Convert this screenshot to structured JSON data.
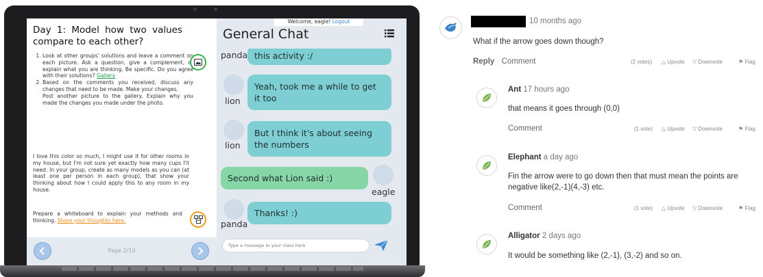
{
  "lesson": {
    "title": "Day 1: Model how two values compare to each other?",
    "steps": [
      {
        "text": "Look at other groups' solutions and leave a comment on each picture. Ask a question, give a complement, or explain what you are thinking. Be specific. Do you agree with their solutions? ",
        "link": "Gallery"
      },
      {
        "text": "Based on the comments you received, discuss any changes that need to be made. Make your changes.",
        "extra": "Post another picture to the gallery. Explain why you made the changes you made under the photo."
      }
    ],
    "paragraph": "I love this color so much, I might use it for other rooms in my house, but I'm not sure yet exactly how many cups I'll need. In your group, create as many models as you can (at least one per person in each group), that show your thinking about how I could apply this to any room in my house.",
    "prepare_text": "Prepare a whiteboard to explain your methods and thinking. ",
    "prepare_link": "Share your thoughts here.",
    "page_label": "Page 2/10",
    "icons": [
      "gallery-icon",
      "whiteboard-icon",
      "prev-arrow-icon",
      "next-arrow-icon"
    ]
  },
  "chat": {
    "welcome": "Welcome, eagle!",
    "logout": "Logout",
    "title": "General Chat",
    "messages": [
      {
        "user": "panda",
        "text": "this activity :/"
      },
      {
        "user": "lion",
        "text": "Yeah, took me a while to get it too"
      },
      {
        "user": "lion",
        "text": "But I think it's about seeing the numbers"
      },
      {
        "user": "eagle",
        "text": "Second what Lion said :)"
      },
      {
        "user": "panda",
        "text": "Thanks! :)"
      }
    ],
    "input_placeholder": "Type a message to your class here",
    "colors": {
      "bubble": "#7ecfd4",
      "own_bubble": "#86d6a8",
      "background": "#e4e8ef"
    }
  },
  "thread": {
    "post": {
      "time": "10 months ago",
      "text": "What if the arrow goes down though?",
      "reply": "Reply",
      "comment": "Comment",
      "votes": "(2 votes)"
    },
    "replies": [
      {
        "author": "Ant",
        "time": "17 hours ago",
        "text": "that means it goes through (0,0)",
        "comment": "Comment",
        "votes": "(1 vote)"
      },
      {
        "author": "Elephant",
        "time": "a day ago",
        "text": "Fin the arrow were to go down then that must mean the points are negative like(2,-1)(4,-3) etc.",
        "comment": "Comment",
        "votes": "(1 vote)"
      },
      {
        "author": "Alligator",
        "time": "2 days ago",
        "text": "It would be something like (2,-1), (3,-2) and so on."
      }
    ],
    "labels": {
      "upvote": "Upvote",
      "downvote": "Downvote",
      "flag": "Flag",
      "separator": "·"
    }
  }
}
